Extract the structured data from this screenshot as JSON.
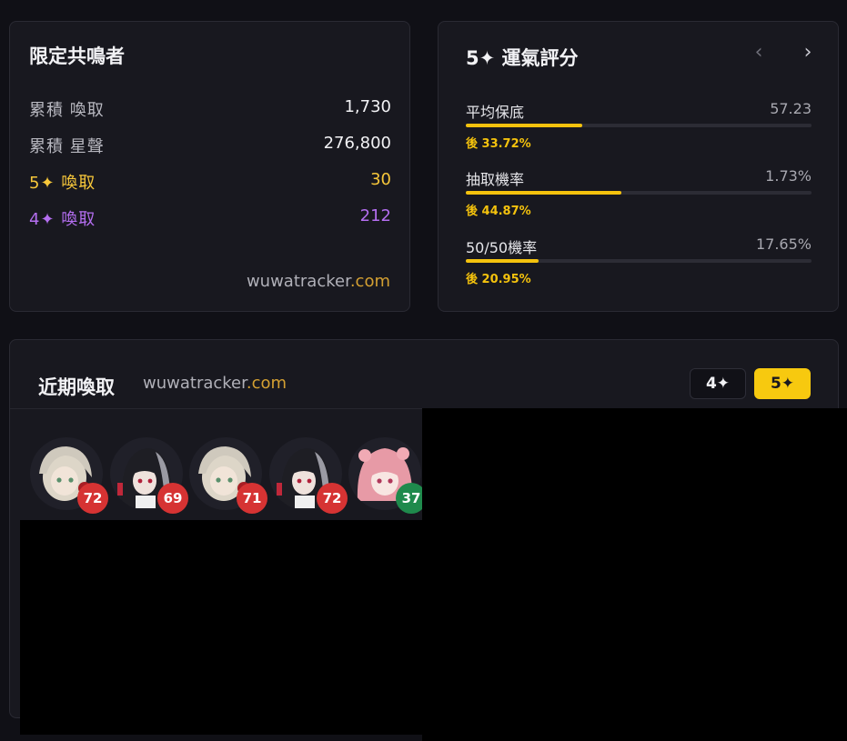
{
  "limited": {
    "title": "限定共鳴者",
    "rows": [
      {
        "label": "累積 喚取",
        "value": "1,730",
        "tone": "white"
      },
      {
        "label": "累積 星聲",
        "value": "276,800",
        "tone": "white"
      },
      {
        "label": "5✦ 喚取",
        "value": "30",
        "tone": "gold"
      },
      {
        "label": "4✦ 喚取",
        "value": "212",
        "tone": "purple"
      }
    ],
    "watermark_main": "wuwatracker",
    "watermark_tld": ".com"
  },
  "luck": {
    "title": "5✦ 運氣評分",
    "prev_icon": "chevron-left-icon",
    "next_icon": "chevron-right-icon",
    "prev_glyph": "‹",
    "next_glyph": "›",
    "metrics": [
      {
        "label": "平均保底",
        "value": "57.23",
        "fill_fraction": 0.3372,
        "percentile": "後 33.72%"
      },
      {
        "label": "抽取機率",
        "value": "1.73%",
        "fill_fraction": 0.4487,
        "percentile": "後 44.87%"
      },
      {
        "label": "50/50機率",
        "value": "17.65%",
        "fill_fraction": 0.2095,
        "percentile": "後 20.95%"
      }
    ],
    "accent_color": "#f4c20d"
  },
  "recent": {
    "title": "近期喚取",
    "watermark_main": "wuwatracker",
    "watermark_tld": ".com",
    "filters": {
      "four_star": "4✦",
      "five_star": "5✦"
    },
    "pulls": [
      {
        "pity": "72",
        "badge_color": "#d63333",
        "portrait": "white-haired-character"
      },
      {
        "pity": "69",
        "badge_color": "#d63333",
        "portrait": "black-haired-character"
      },
      {
        "pity": "71",
        "badge_color": "#d63333",
        "portrait": "white-haired-character"
      },
      {
        "pity": "72",
        "badge_color": "#d63333",
        "portrait": "black-haired-character"
      },
      {
        "pity": "37",
        "badge_color": "#1f8a4c",
        "portrait": "pink-haired-character"
      }
    ]
  }
}
